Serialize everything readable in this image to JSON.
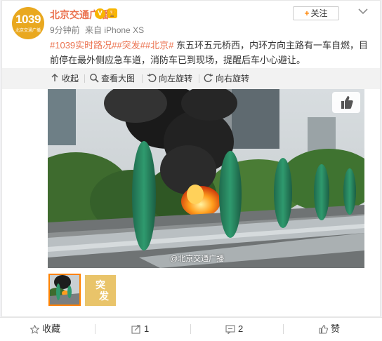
{
  "post": {
    "avatar": {
      "big": "1039",
      "small": "北京交通广播"
    },
    "author": "北京交通广播",
    "verified_icon": "V",
    "level_icon": "🏆",
    "time": "9分钟前",
    "source": "来自 iPhone XS",
    "follow_label": "关注",
    "text_links": [
      "#1039实时路况#",
      "#突发#",
      "#北京#"
    ],
    "text_body": " 东五环五元桥西，内环方向主路有一车自燃，目前停在最外侧应急车道，消防车已到现场，提醒后车小心避让。",
    "watermark": "@北京交通广播"
  },
  "media_toolbar": {
    "collapse": "收起",
    "view_large": "查看大图",
    "rotate_left": "向左旋转",
    "rotate_right": "向右旋转"
  },
  "thumbnails": {
    "second_label_line1": "突",
    "second_label_line2": "发"
  },
  "actions": {
    "favorite": "收藏",
    "repost": "1",
    "comment": "2",
    "like": "赞"
  },
  "colors": {
    "accent": "#eb7350",
    "orange": "#ff8200",
    "avatar_bg": "#e9a81f"
  },
  "icons": [
    "chevron-down-icon",
    "collapse-icon",
    "zoom-icon",
    "rotate-left-icon",
    "rotate-right-icon",
    "like-icon",
    "star-icon",
    "repost-icon",
    "comment-icon"
  ]
}
